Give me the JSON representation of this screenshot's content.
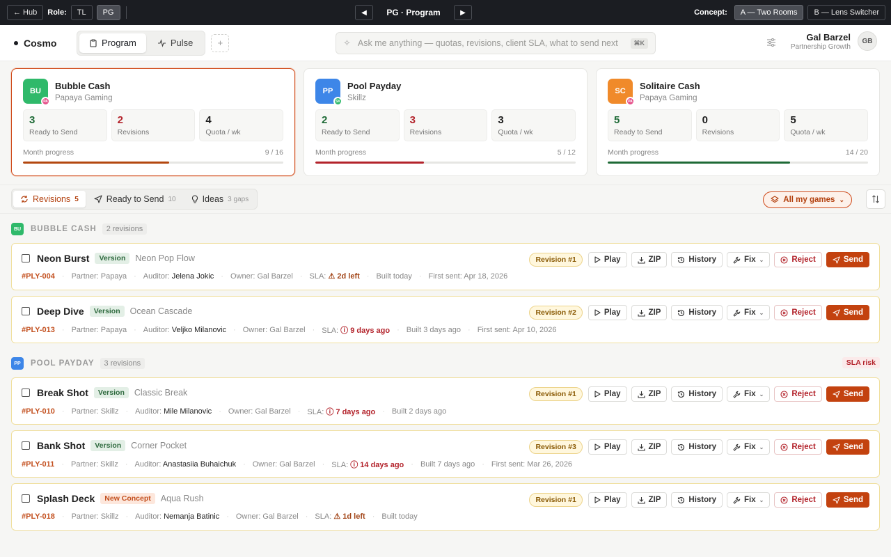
{
  "topbar": {
    "hub_label": "← Hub",
    "role_label": "Role:",
    "roles": [
      "TL",
      "PG"
    ],
    "active_role": "PG",
    "title": "PG · Program",
    "concept_label": "Concept:",
    "concepts": [
      "A — Two Rooms",
      "B — Lens Switcher"
    ]
  },
  "header": {
    "brand": "Cosmo",
    "tabs": [
      "Program",
      "Pulse"
    ],
    "add_tab": "+",
    "search_placeholder": "Ask me anything — quotas, revisions, client SLA, what to send next",
    "search_shortcut": "⌘K",
    "user_name": "Gal Barzel",
    "user_role": "Partnership Growth",
    "user_initials": "GB"
  },
  "cards": [
    {
      "initials": "BU",
      "color": "#2fb96a",
      "name": "Bubble Cash",
      "partner": "Papaya Gaming",
      "partner_initials": "PA",
      "partner_color": "#e5508a",
      "ready": "3",
      "ready_label": "Ready to Send",
      "revisions": "2",
      "revisions_label": "Revisions",
      "quota": "4",
      "quota_label": "Quota / wk",
      "progress_label": "Month progress",
      "progress_text": "9 / 16",
      "progress": 0.5625,
      "progress_color": "#b3470f"
    },
    {
      "initials": "PP",
      "color": "#3d86e8",
      "name": "Pool Payday",
      "partner": "Skillz",
      "partner_initials": "SK",
      "partner_color": "#2fb96a",
      "ready": "2",
      "ready_label": "Ready to Send",
      "revisions": "3",
      "revisions_label": "Revisions",
      "quota": "3",
      "quota_label": "Quota / wk",
      "progress_label": "Month progress",
      "progress_text": "5 / 12",
      "progress": 0.4167,
      "progress_color": "#b3232b"
    },
    {
      "initials": "SC",
      "color": "#f08a2a",
      "name": "Solitaire Cash",
      "partner": "Papaya Gaming",
      "partner_initials": "PA",
      "partner_color": "#e5508a",
      "ready": "5",
      "ready_label": "Ready to Send",
      "revisions": "0",
      "revisions_label": "Revisions",
      "quota": "5",
      "quota_label": "Quota / wk",
      "progress_label": "Month progress",
      "progress_text": "14 / 20",
      "progress": 0.7,
      "progress_color": "#1e6a36"
    }
  ],
  "filters": {
    "tabs": [
      {
        "label": "Revisions",
        "count": "5"
      },
      {
        "label": "Ready to Send",
        "count": "10"
      },
      {
        "label": "Ideas",
        "count": "3 gaps"
      }
    ],
    "all_games": "All my games"
  },
  "actions": {
    "play": "Play",
    "zip": "ZIP",
    "history": "History",
    "fix": "Fix",
    "reject": "Reject",
    "send": "Send"
  },
  "groups": [
    {
      "initials": "BU",
      "color": "#2fb96a",
      "name": "BUBBLE CASH",
      "count": "2 revisions",
      "risk": "",
      "rows": [
        {
          "name": "Neon Burst",
          "tag": "Version",
          "tag_type": "version",
          "concept": "Neon Pop Flow",
          "revision": "Revision #1",
          "id": "#PLY-004",
          "partner": "Partner: Papaya",
          "auditor_label": "Auditor:",
          "auditor": "Jelena Jokic",
          "owner": "Owner: Gal Barzel",
          "sla_label": "SLA:",
          "sla_icon": "⚠",
          "sla": "2d left",
          "sla_type": "warn",
          "built": "Built today",
          "first_sent": "First sent: Apr 18, 2026"
        },
        {
          "name": "Deep Dive",
          "tag": "Version",
          "tag_type": "version",
          "concept": "Ocean Cascade",
          "revision": "Revision #2",
          "id": "#PLY-013",
          "partner": "Partner: Papaya",
          "auditor_label": "Auditor:",
          "auditor": "Veljko Milanovic",
          "owner": "Owner: Gal Barzel",
          "sla_label": "SLA:",
          "sla_icon": "ⓘ",
          "sla": "9 days ago",
          "sla_type": "over",
          "built": "Built 3 days ago",
          "first_sent": "First sent: Apr 10, 2026"
        }
      ]
    },
    {
      "initials": "PP",
      "color": "#3d86e8",
      "name": "POOL PAYDAY",
      "count": "3 revisions",
      "risk": "SLA risk",
      "rows": [
        {
          "name": "Break Shot",
          "tag": "Version",
          "tag_type": "version",
          "concept": "Classic Break",
          "revision": "Revision #1",
          "id": "#PLY-010",
          "partner": "Partner: Skillz",
          "auditor_label": "Auditor:",
          "auditor": "Mile Milanovic",
          "owner": "Owner: Gal Barzel",
          "sla_label": "SLA:",
          "sla_icon": "ⓘ",
          "sla": "7 days ago",
          "sla_type": "over",
          "built": "Built 2 days ago",
          "first_sent": ""
        },
        {
          "name": "Bank Shot",
          "tag": "Version",
          "tag_type": "version",
          "concept": "Corner Pocket",
          "revision": "Revision #3",
          "id": "#PLY-011",
          "partner": "Partner: Skillz",
          "auditor_label": "Auditor:",
          "auditor": "Anastasiia Buhaichuk",
          "owner": "Owner: Gal Barzel",
          "sla_label": "SLA:",
          "sla_icon": "ⓘ",
          "sla": "14 days ago",
          "sla_type": "over",
          "built": "Built 7 days ago",
          "first_sent": "First sent: Mar 26, 2026"
        },
        {
          "name": "Splash Deck",
          "tag": "New Concept",
          "tag_type": "new",
          "concept": "Aqua Rush",
          "revision": "Revision #1",
          "id": "#PLY-018",
          "partner": "Partner: Skillz",
          "auditor_label": "Auditor:",
          "auditor": "Nemanja Batinic",
          "owner": "Owner: Gal Barzel",
          "sla_label": "SLA:",
          "sla_icon": "⚠",
          "sla": "1d left",
          "sla_type": "warn",
          "built": "Built today",
          "first_sent": ""
        }
      ]
    }
  ]
}
